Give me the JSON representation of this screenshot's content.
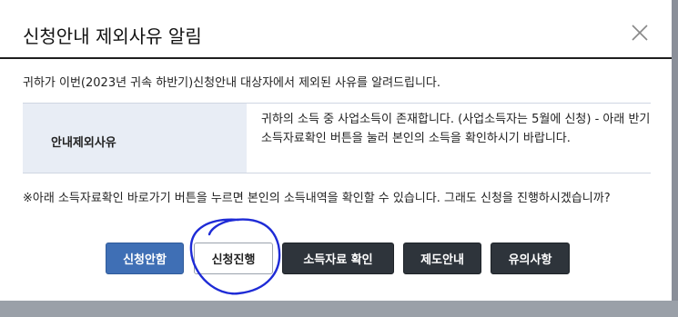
{
  "dialog": {
    "title": "신청안내 제외사유 알림",
    "close_icon": "close-icon",
    "intro": "귀하가 이번(2023년 귀속 하반기)신청안내 대상자에서 제외된 사유를 알려드립니다.",
    "table": {
      "label": "안내제외사유",
      "value": "귀하의 소득 중 사업소득이 존재합니다. (사업소득자는 5월에 신청) - 아래 반기소득자료확인 버튼을 눌러 본인의 소득을 확인하시기 바랍니다."
    },
    "notice": "※아래 소득자료확인 바로가기 버튼을 누르면 본인의 소득내역을 확인할 수 있습니다. 그래도 신청을 진행하시겠습니까?",
    "buttons": {
      "cancel": "신청안함",
      "proceed": "신청진행",
      "income_check": "소득자료 확인",
      "system_guide": "제도안내",
      "notes": "유의사항"
    }
  },
  "colors": {
    "primary_button": "#3f6fb5",
    "dark_button": "#2e343b",
    "table_label_bg": "#e8edf5",
    "annotation": "#1e2bd6"
  }
}
